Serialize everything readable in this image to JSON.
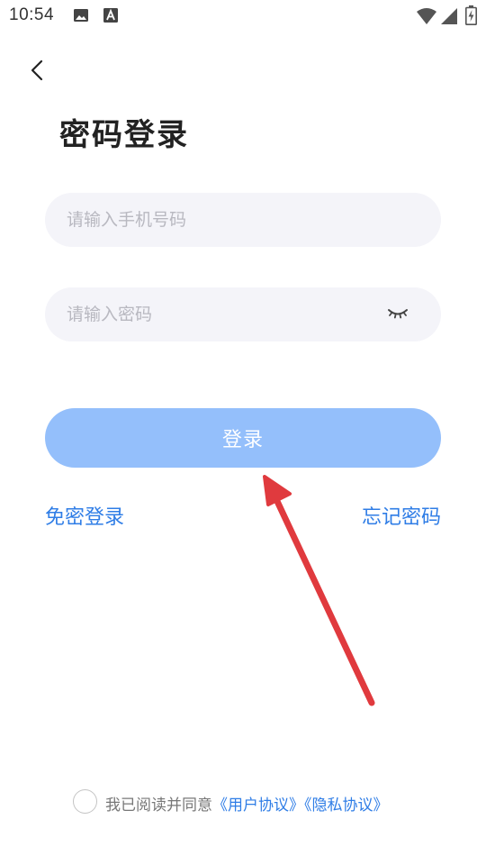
{
  "status_bar": {
    "time": "10:54",
    "icons": [
      "image-icon",
      "text-a-icon",
      "wifi-icon",
      "signal-icon",
      "battery-charging-icon"
    ]
  },
  "header": {
    "back_icon": "chevron-left-icon",
    "title": "密码登录"
  },
  "form": {
    "phone_placeholder": "请输入手机号码",
    "phone_value": "",
    "password_placeholder": "请输入密码",
    "password_value": "",
    "password_toggle_icon": "eye-closed-icon",
    "login_label": "登录"
  },
  "links": {
    "sms_login": "免密登录",
    "forgot_password": "忘记密码"
  },
  "agreement": {
    "checked": false,
    "prefix": "我已阅读并同意",
    "user_agreement": "《用户协议》",
    "privacy_policy": "《隐私协议》"
  },
  "colors": {
    "accent": "#2f7de6",
    "button_disabled": "#94bffb",
    "field_background": "#f4f4f9",
    "annotation_arrow": "#e03a3e"
  }
}
